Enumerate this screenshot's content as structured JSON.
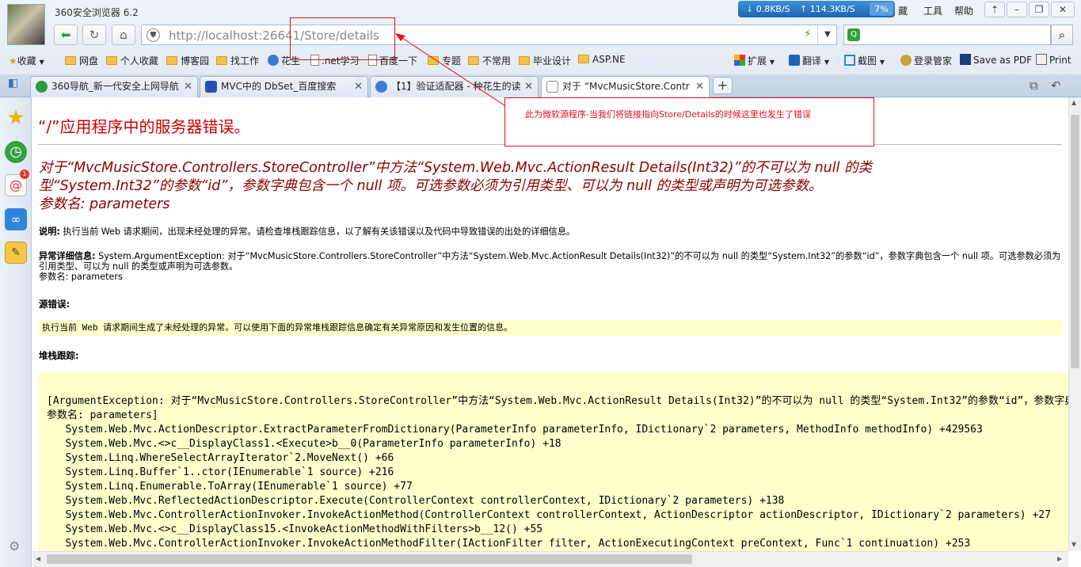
{
  "browser": {
    "title": "360安全浏览器 6.2",
    "net": {
      "down": "0.8KB/S",
      "up": "114.3KB/S",
      "percent": "7%"
    },
    "menu": [
      "藏",
      "工具",
      "帮助"
    ]
  },
  "address": {
    "url_host": "http://localhost",
    "url_rest": ":26641/Store/details",
    "search_value": ""
  },
  "favorites": [
    {
      "label": "收藏",
      "kind": "star"
    },
    {
      "label": "网盘",
      "kind": "folder"
    },
    {
      "label": "个人收藏",
      "kind": "folder"
    },
    {
      "label": "博客园",
      "kind": "folder"
    },
    {
      "label": "找工作",
      "kind": "folder"
    },
    {
      "label": "花生",
      "kind": "globe"
    },
    {
      "label": ".net学习",
      "kind": "page"
    },
    {
      "label": "百度一下",
      "kind": "page"
    },
    {
      "label": "专题",
      "kind": "folder"
    },
    {
      "label": "不常用",
      "kind": "folder"
    },
    {
      "label": "毕业设计",
      "kind": "folder"
    },
    {
      "label": "ASP.NE",
      "kind": "folder"
    }
  ],
  "tools": [
    {
      "label": "扩展"
    },
    {
      "label": "翻译"
    },
    {
      "label": "截图"
    },
    {
      "label": "登录管家"
    },
    {
      "label": "Save as PDF"
    },
    {
      "label": "Print"
    }
  ],
  "tabs": [
    {
      "label": "360导航_新一代安全上网导航",
      "color": "#2d9b3c"
    },
    {
      "label": "MVC中的 DbSet_百度搜索",
      "color": "#2a4fb3"
    },
    {
      "label": "【1】验证适配器 - 种花生的读",
      "color": "#3a7bd5"
    },
    {
      "label": "对于 “MvcMusicStore.Contr",
      "color": "#888888"
    }
  ],
  "page": {
    "title": "“/”应用程序中的服务器错误。",
    "error_message": "对于“MvcMusicStore.Controllers.StoreController”中方法“System.Web.Mvc.ActionResult Details(Int32)”的不可以为 null 的类型“System.Int32”的参数“id”，参数字典包含一个 null 项。可选参数必须为引用类型、可以为 null 的类型或声明为可选参数。",
    "param_line": "参数名: parameters",
    "desc_label": "说明:",
    "desc_text": "执行当前 Web 请求期间，出现未经处理的异常。请检查堆栈跟踪信息，以了解有关该错误以及代码中导致错误的出处的详细信息。",
    "exc_label": "异常详细信息:",
    "exc_text": "System.ArgumentException: 对于“MvcMusicStore.Controllers.StoreController”中方法“System.Web.Mvc.ActionResult Details(Int32)”的不可以为 null 的类型“System.Int32”的参数“id”，参数字典包含一个 null 项。可选参数必须为引用类型、可以为 null 的类型或声明为可选参数。",
    "exc_param": "参数名: parameters",
    "source_label": "源错误:",
    "source_text": "执行当前 Web 请求期间生成了未经处理的异常。可以使用下面的异常堆栈跟踪信息确定有关异常原因和发生位置的信息。",
    "stack_label": "堆栈跟踪:",
    "stack_lines": [
      "[ArgumentException: 对于“MvcMusicStore.Controllers.StoreController”中方法“System.Web.Mvc.ActionResult Details(Int32)”的不可以为 null 的类型“System.Int32”的参数“id”，参数字典包含一个 null 项。",
      "参数名: parameters]",
      "   System.Web.Mvc.ActionDescriptor.ExtractParameterFromDictionary(ParameterInfo parameterInfo, IDictionary`2 parameters, MethodInfo methodInfo) +429563",
      "   System.Web.Mvc.<>c__DisplayClass1.<Execute>b__0(ParameterInfo parameterInfo) +18",
      "   System.Linq.WhereSelectArrayIterator`2.MoveNext() +66",
      "   System.Linq.Buffer`1..ctor(IEnumerable`1 source) +216",
      "   System.Linq.Enumerable.ToArray(IEnumerable`1 source) +77",
      "   System.Web.Mvc.ReflectedActionDescriptor.Execute(ControllerContext controllerContext, IDictionary`2 parameters) +138",
      "   System.Web.Mvc.ControllerActionInvoker.InvokeActionMethod(ControllerContext controllerContext, ActionDescriptor actionDescriptor, IDictionary`2 parameters) +27",
      "   System.Web.Mvc.<>c__DisplayClass15.<InvokeActionMethodWithFilters>b__12() +55",
      "   System.Web.Mvc.ControllerActionInvoker.InvokeActionMethodFilter(IActionFilter filter, ActionExecutingContext preContext, Func`1 continuation) +253"
    ]
  },
  "annotation": {
    "text": "此为微软源程序-当我们将链接指向Store/Details的时候这里也发生了错误",
    "color": "#e0101e"
  },
  "icons": [
    "back-icon",
    "refresh-icon",
    "home-icon",
    "shield-icon",
    "bolt-icon",
    "search-icon",
    "favorites-star-icon",
    "history-clock-icon",
    "mail-icon",
    "cloud-sync-icon",
    "notes-icon",
    "settings-gear-icon",
    "pin-icon",
    "restore-window-icon",
    "close-window-icon"
  ]
}
